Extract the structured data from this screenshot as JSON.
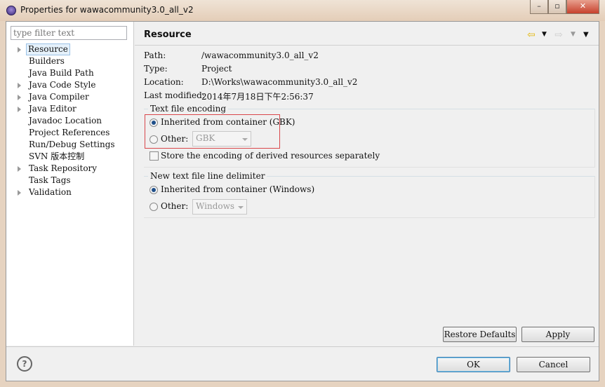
{
  "window": {
    "title": "Properties for wawacommunity3.0_all_v2",
    "controls": [
      "minimize",
      "maximize",
      "close"
    ]
  },
  "filter": {
    "placeholder": "type filter text"
  },
  "tree": [
    {
      "label": "Resource",
      "expandable": true,
      "selected": true
    },
    {
      "label": "Builders",
      "expandable": false
    },
    {
      "label": "Java Build Path",
      "expandable": false
    },
    {
      "label": "Java Code Style",
      "expandable": true
    },
    {
      "label": "Java Compiler",
      "expandable": true
    },
    {
      "label": "Java Editor",
      "expandable": true
    },
    {
      "label": "Javadoc Location",
      "expandable": false
    },
    {
      "label": "Project References",
      "expandable": false
    },
    {
      "label": "Run/Debug Settings",
      "expandable": false
    },
    {
      "label": "SVN 版本控制",
      "expandable": false
    },
    {
      "label": "Task Repository",
      "expandable": true
    },
    {
      "label": "Task Tags",
      "expandable": false
    },
    {
      "label": "Validation",
      "expandable": true
    }
  ],
  "page": {
    "title": "Resource",
    "info": [
      {
        "label": "Path:",
        "value": "/wawacommunity3.0_all_v2"
      },
      {
        "label": "Type:",
        "value": "Project"
      },
      {
        "label": "Location:",
        "value": "D:\\Works\\wawacommunity3.0_all_v2"
      },
      {
        "label": "Last modified:",
        "value": "2014年7月18日下午2:56:37"
      }
    ],
    "encoding": {
      "title": "Text file encoding",
      "inherited": "Inherited from container (GBK)",
      "other": "Other:",
      "other_value": "GBK",
      "selected": "inherited",
      "store_derived": "Store the encoding of derived resources separately",
      "store_derived_checked": false,
      "highlight_color": "#d9474b"
    },
    "delimiter": {
      "title": "New text file line delimiter",
      "inherited": "Inherited from container (Windows)",
      "other": "Other:",
      "other_value": "Windows",
      "selected": "inherited"
    }
  },
  "buttons": {
    "restore": "Restore Defaults",
    "apply": "Apply",
    "ok": "OK",
    "cancel": "Cancel"
  }
}
